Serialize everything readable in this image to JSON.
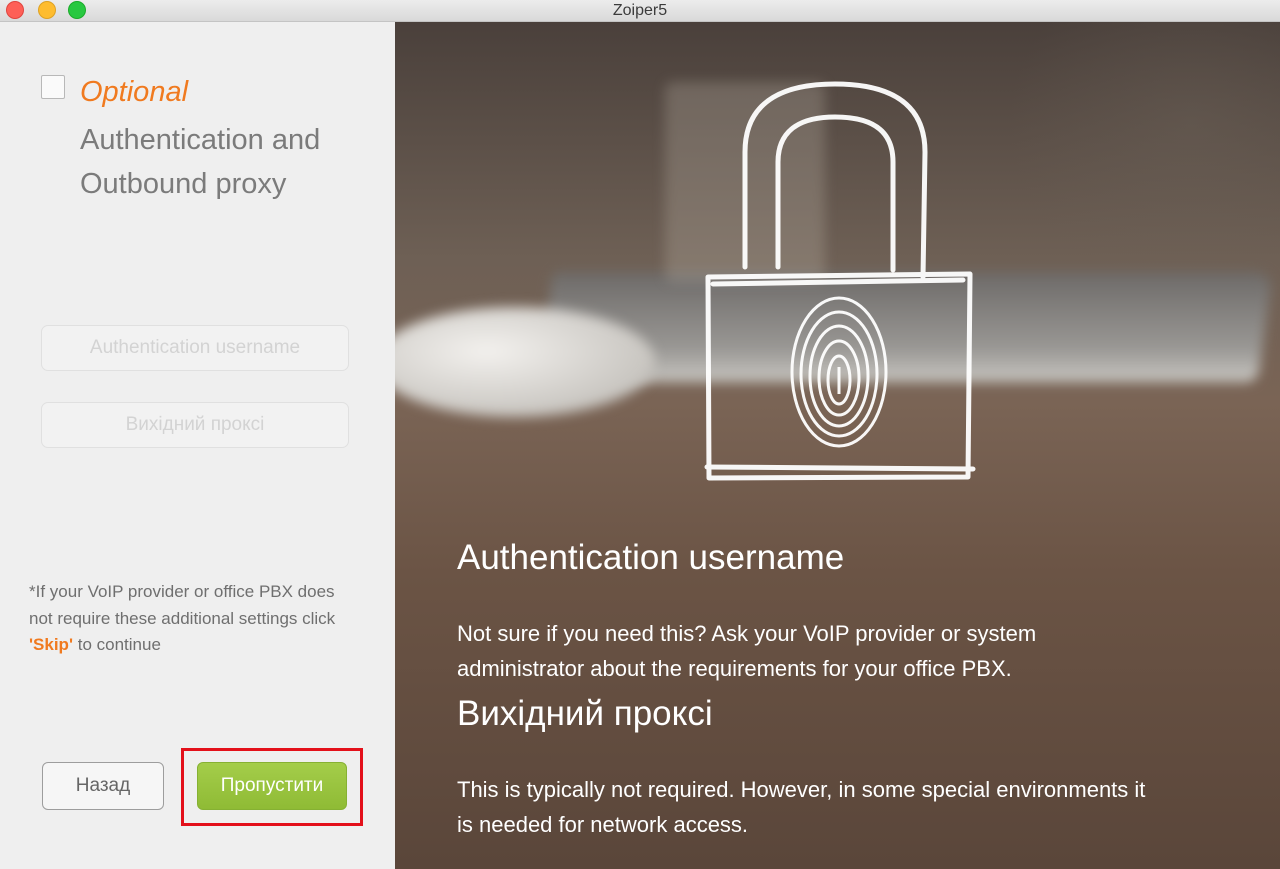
{
  "window": {
    "title": "Zoiper5"
  },
  "left_panel": {
    "optional_label": "Optional",
    "heading_line1": "Authentication and",
    "heading_line2": "Outbound proxy",
    "auth_username_placeholder": "Authentication username",
    "outbound_proxy_placeholder": "Вихідний проксі",
    "note_prefix": "*If your VoIP provider or office PBX does not require these additional settings click ",
    "note_skip_word": "'Skip'",
    "note_suffix": " to continue",
    "back_button": "Назад",
    "skip_button": "Пропустити"
  },
  "right_panel": {
    "auth_title": "Authentication username",
    "auth_desc": " Not sure if you need this? Ask your VoIP provider or system administrator about the requirements for your office PBX.",
    "proxy_title": "Вихідний проксі",
    "proxy_desc": " This is typically not required. However, in some special environments it is needed for network access."
  },
  "colors": {
    "accent_orange": "#f07a1f",
    "skip_green": "#97c23d",
    "highlight_red": "#e3101a"
  },
  "icons": [
    "padlock-fingerprint-icon"
  ]
}
